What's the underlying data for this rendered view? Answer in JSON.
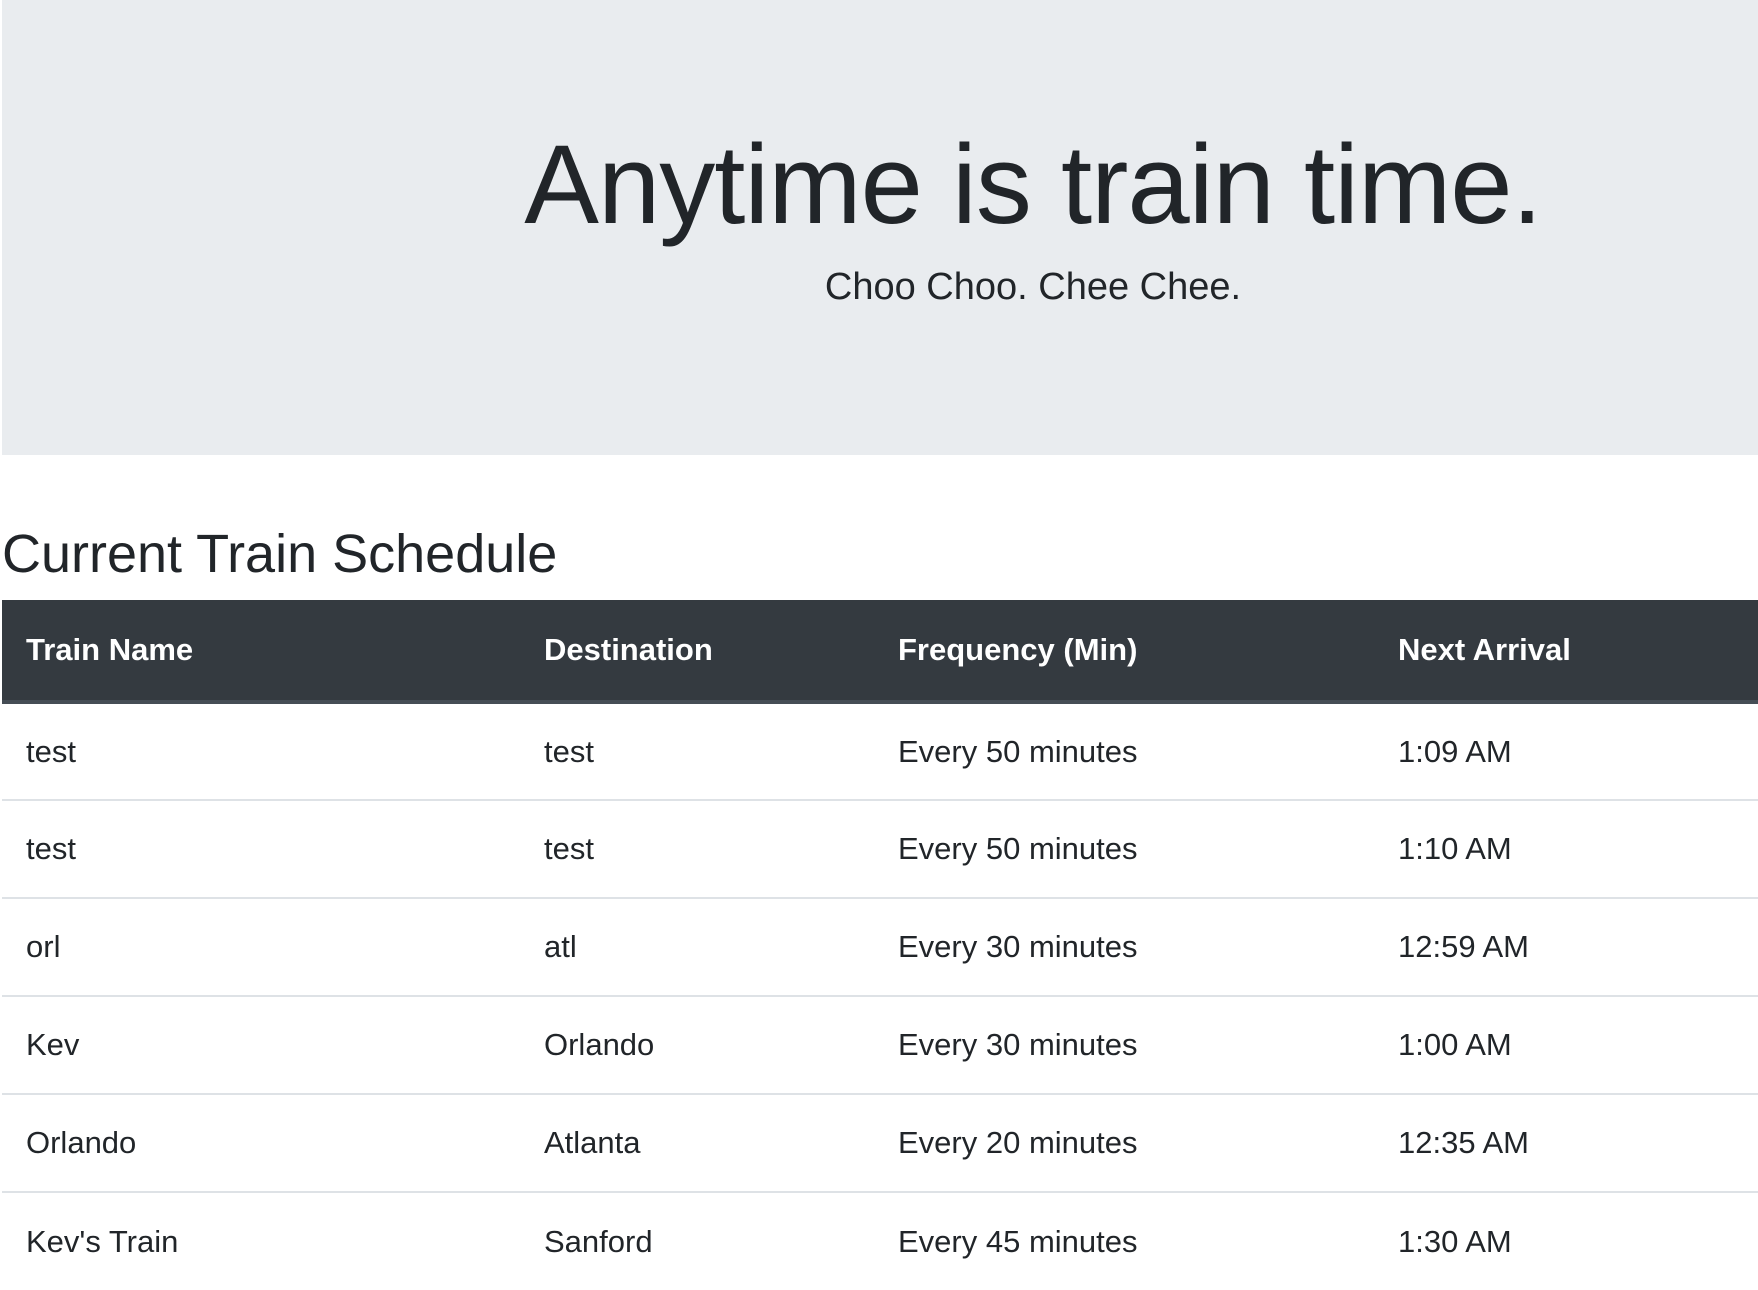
{
  "hero": {
    "title": "Anytime is train time.",
    "subtitle": "Choo Choo. Chee Chee."
  },
  "schedule": {
    "title": "Current Train Schedule",
    "columns": [
      "Train Name",
      "Destination",
      "Frequency (Min)",
      "Next Arrival"
    ],
    "rows": [
      [
        "test",
        "test",
        "Every 50 minutes",
        "1:09 AM"
      ],
      [
        "test",
        "test",
        "Every 50 minutes",
        "1:10 AM"
      ],
      [
        "orl",
        "atl",
        "Every 30 minutes",
        "12:59 AM"
      ],
      [
        "Kev",
        "Orlando",
        "Every 30 minutes",
        "1:00 AM"
      ],
      [
        "Orlando",
        "Atlanta",
        "Every 20 minutes",
        "12:35 AM"
      ],
      [
        "Kev's Train",
        "Sanford",
        "Every 45 minutes",
        "1:30 AM"
      ]
    ]
  },
  "colors": {
    "jumbotron_bg": "#e9ecef",
    "table_header_bg": "#343a40",
    "text": "#212529",
    "row_divider": "#dee2e6"
  }
}
